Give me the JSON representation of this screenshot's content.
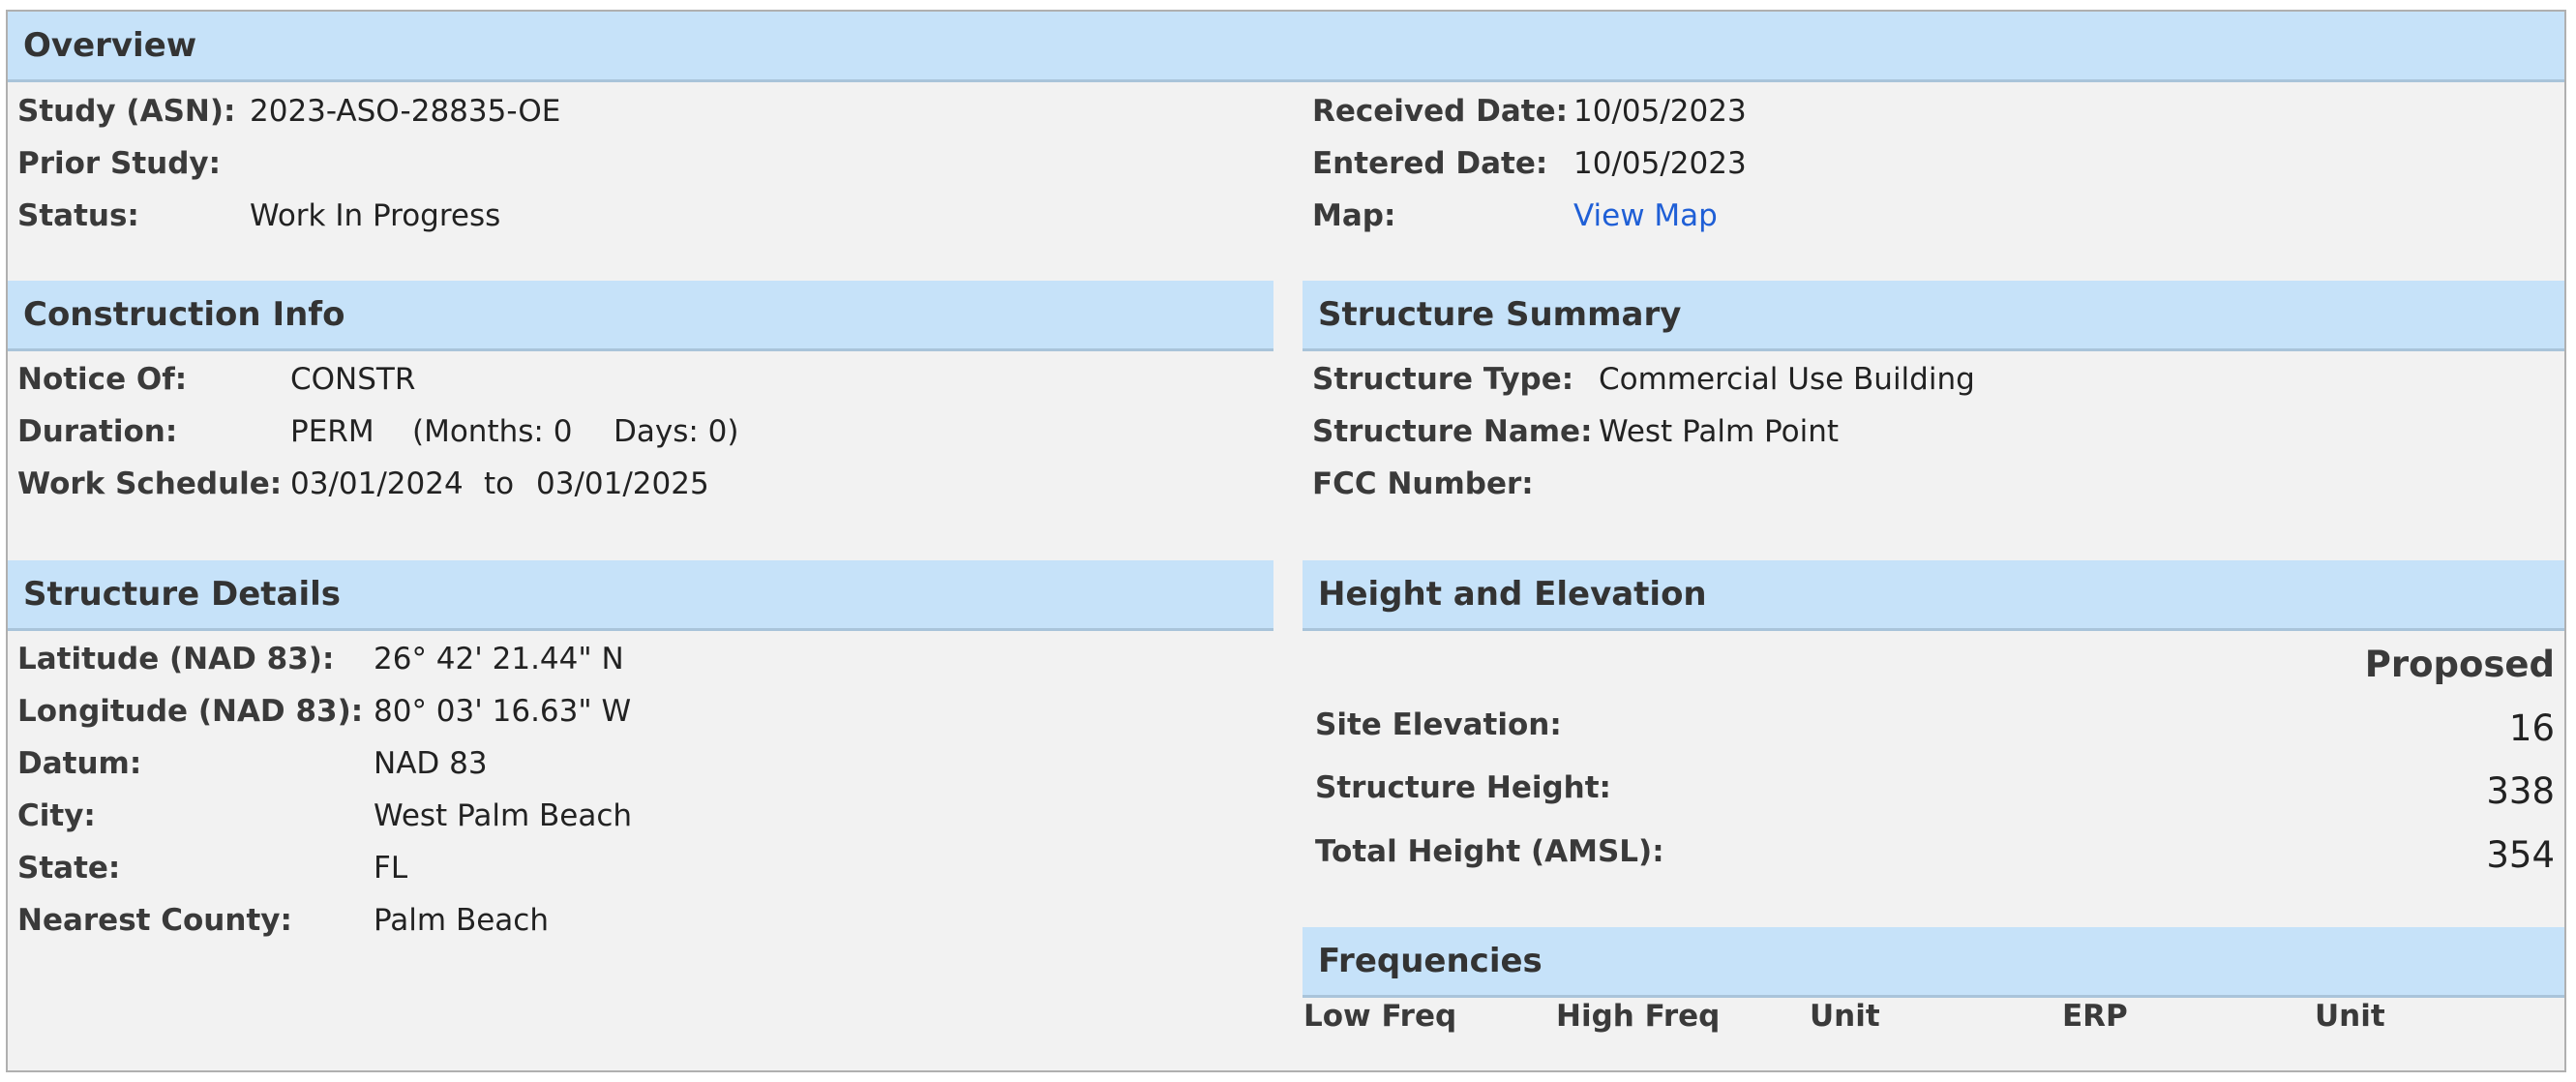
{
  "overview": {
    "title": "Overview",
    "study_label": "Study (ASN):",
    "study_value": "2023-ASO-28835-OE",
    "prior_label": "Prior Study:",
    "prior_value": "",
    "status_label": "Status:",
    "status_value": "Work In Progress",
    "received_label": "Received Date:",
    "received_value": "10/05/2023",
    "entered_label": "Entered Date:",
    "entered_value": "10/05/2023",
    "map_label": "Map:",
    "map_link": "View Map"
  },
  "construction": {
    "title": "Construction Info",
    "notice_label": "Notice Of:",
    "notice_value": "CONSTR",
    "duration_label": "Duration:",
    "duration_value": "PERM",
    "months_text": "(Months: 0",
    "days_text": "Days: 0)",
    "schedule_label": "Work Schedule:",
    "schedule_start": "03/01/2024",
    "schedule_to": "to",
    "schedule_end": "03/01/2025"
  },
  "summary": {
    "title": "Structure Summary",
    "type_label": "Structure Type:",
    "type_value": "Commercial Use Building",
    "name_label": "Structure Name:",
    "name_value": "West Palm Point",
    "fcc_label": "FCC Number:",
    "fcc_value": ""
  },
  "details": {
    "title": "Structure Details",
    "lat_label": "Latitude (NAD 83):",
    "lat_value": "26° 42' 21.44\" N",
    "lon_label": "Longitude (NAD 83):",
    "lon_value": "80° 03' 16.63\" W",
    "datum_label": "Datum:",
    "datum_value": "NAD 83",
    "city_label": "City:",
    "city_value": "West Palm Beach",
    "state_label": "State:",
    "state_value": "FL",
    "county_label": "Nearest County:",
    "county_value": "Palm Beach"
  },
  "height": {
    "title": "Height and Elevation",
    "column_header": "Proposed",
    "site_label": "Site Elevation:",
    "site_value": "16",
    "structure_label": "Structure Height:",
    "structure_value": "338",
    "total_label": "Total Height (AMSL):",
    "total_value": "354"
  },
  "frequencies": {
    "title": "Frequencies",
    "columns": [
      "Low Freq",
      "High Freq",
      "Unit",
      "ERP",
      "Unit"
    ]
  }
}
